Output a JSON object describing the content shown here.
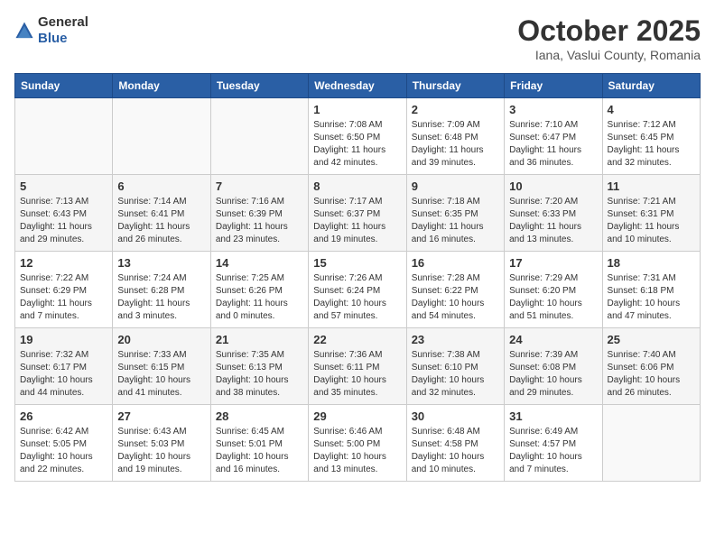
{
  "logo": {
    "general": "General",
    "blue": "Blue"
  },
  "header": {
    "title": "October 2025",
    "subtitle": "Iana, Vaslui County, Romania"
  },
  "weekdays": [
    "Sunday",
    "Monday",
    "Tuesday",
    "Wednesday",
    "Thursday",
    "Friday",
    "Saturday"
  ],
  "weeks": [
    [
      {
        "day": "",
        "info": ""
      },
      {
        "day": "",
        "info": ""
      },
      {
        "day": "",
        "info": ""
      },
      {
        "day": "1",
        "info": "Sunrise: 7:08 AM\nSunset: 6:50 PM\nDaylight: 11 hours\nand 42 minutes."
      },
      {
        "day": "2",
        "info": "Sunrise: 7:09 AM\nSunset: 6:48 PM\nDaylight: 11 hours\nand 39 minutes."
      },
      {
        "day": "3",
        "info": "Sunrise: 7:10 AM\nSunset: 6:47 PM\nDaylight: 11 hours\nand 36 minutes."
      },
      {
        "day": "4",
        "info": "Sunrise: 7:12 AM\nSunset: 6:45 PM\nDaylight: 11 hours\nand 32 minutes."
      }
    ],
    [
      {
        "day": "5",
        "info": "Sunrise: 7:13 AM\nSunset: 6:43 PM\nDaylight: 11 hours\nand 29 minutes."
      },
      {
        "day": "6",
        "info": "Sunrise: 7:14 AM\nSunset: 6:41 PM\nDaylight: 11 hours\nand 26 minutes."
      },
      {
        "day": "7",
        "info": "Sunrise: 7:16 AM\nSunset: 6:39 PM\nDaylight: 11 hours\nand 23 minutes."
      },
      {
        "day": "8",
        "info": "Sunrise: 7:17 AM\nSunset: 6:37 PM\nDaylight: 11 hours\nand 19 minutes."
      },
      {
        "day": "9",
        "info": "Sunrise: 7:18 AM\nSunset: 6:35 PM\nDaylight: 11 hours\nand 16 minutes."
      },
      {
        "day": "10",
        "info": "Sunrise: 7:20 AM\nSunset: 6:33 PM\nDaylight: 11 hours\nand 13 minutes."
      },
      {
        "day": "11",
        "info": "Sunrise: 7:21 AM\nSunset: 6:31 PM\nDaylight: 11 hours\nand 10 minutes."
      }
    ],
    [
      {
        "day": "12",
        "info": "Sunrise: 7:22 AM\nSunset: 6:29 PM\nDaylight: 11 hours\nand 7 minutes."
      },
      {
        "day": "13",
        "info": "Sunrise: 7:24 AM\nSunset: 6:28 PM\nDaylight: 11 hours\nand 3 minutes."
      },
      {
        "day": "14",
        "info": "Sunrise: 7:25 AM\nSunset: 6:26 PM\nDaylight: 11 hours\nand 0 minutes."
      },
      {
        "day": "15",
        "info": "Sunrise: 7:26 AM\nSunset: 6:24 PM\nDaylight: 10 hours\nand 57 minutes."
      },
      {
        "day": "16",
        "info": "Sunrise: 7:28 AM\nSunset: 6:22 PM\nDaylight: 10 hours\nand 54 minutes."
      },
      {
        "day": "17",
        "info": "Sunrise: 7:29 AM\nSunset: 6:20 PM\nDaylight: 10 hours\nand 51 minutes."
      },
      {
        "day": "18",
        "info": "Sunrise: 7:31 AM\nSunset: 6:18 PM\nDaylight: 10 hours\nand 47 minutes."
      }
    ],
    [
      {
        "day": "19",
        "info": "Sunrise: 7:32 AM\nSunset: 6:17 PM\nDaylight: 10 hours\nand 44 minutes."
      },
      {
        "day": "20",
        "info": "Sunrise: 7:33 AM\nSunset: 6:15 PM\nDaylight: 10 hours\nand 41 minutes."
      },
      {
        "day": "21",
        "info": "Sunrise: 7:35 AM\nSunset: 6:13 PM\nDaylight: 10 hours\nand 38 minutes."
      },
      {
        "day": "22",
        "info": "Sunrise: 7:36 AM\nSunset: 6:11 PM\nDaylight: 10 hours\nand 35 minutes."
      },
      {
        "day": "23",
        "info": "Sunrise: 7:38 AM\nSunset: 6:10 PM\nDaylight: 10 hours\nand 32 minutes."
      },
      {
        "day": "24",
        "info": "Sunrise: 7:39 AM\nSunset: 6:08 PM\nDaylight: 10 hours\nand 29 minutes."
      },
      {
        "day": "25",
        "info": "Sunrise: 7:40 AM\nSunset: 6:06 PM\nDaylight: 10 hours\nand 26 minutes."
      }
    ],
    [
      {
        "day": "26",
        "info": "Sunrise: 6:42 AM\nSunset: 5:05 PM\nDaylight: 10 hours\nand 22 minutes."
      },
      {
        "day": "27",
        "info": "Sunrise: 6:43 AM\nSunset: 5:03 PM\nDaylight: 10 hours\nand 19 minutes."
      },
      {
        "day": "28",
        "info": "Sunrise: 6:45 AM\nSunset: 5:01 PM\nDaylight: 10 hours\nand 16 minutes."
      },
      {
        "day": "29",
        "info": "Sunrise: 6:46 AM\nSunset: 5:00 PM\nDaylight: 10 hours\nand 13 minutes."
      },
      {
        "day": "30",
        "info": "Sunrise: 6:48 AM\nSunset: 4:58 PM\nDaylight: 10 hours\nand 10 minutes."
      },
      {
        "day": "31",
        "info": "Sunrise: 6:49 AM\nSunset: 4:57 PM\nDaylight: 10 hours\nand 7 minutes."
      },
      {
        "day": "",
        "info": ""
      }
    ]
  ]
}
